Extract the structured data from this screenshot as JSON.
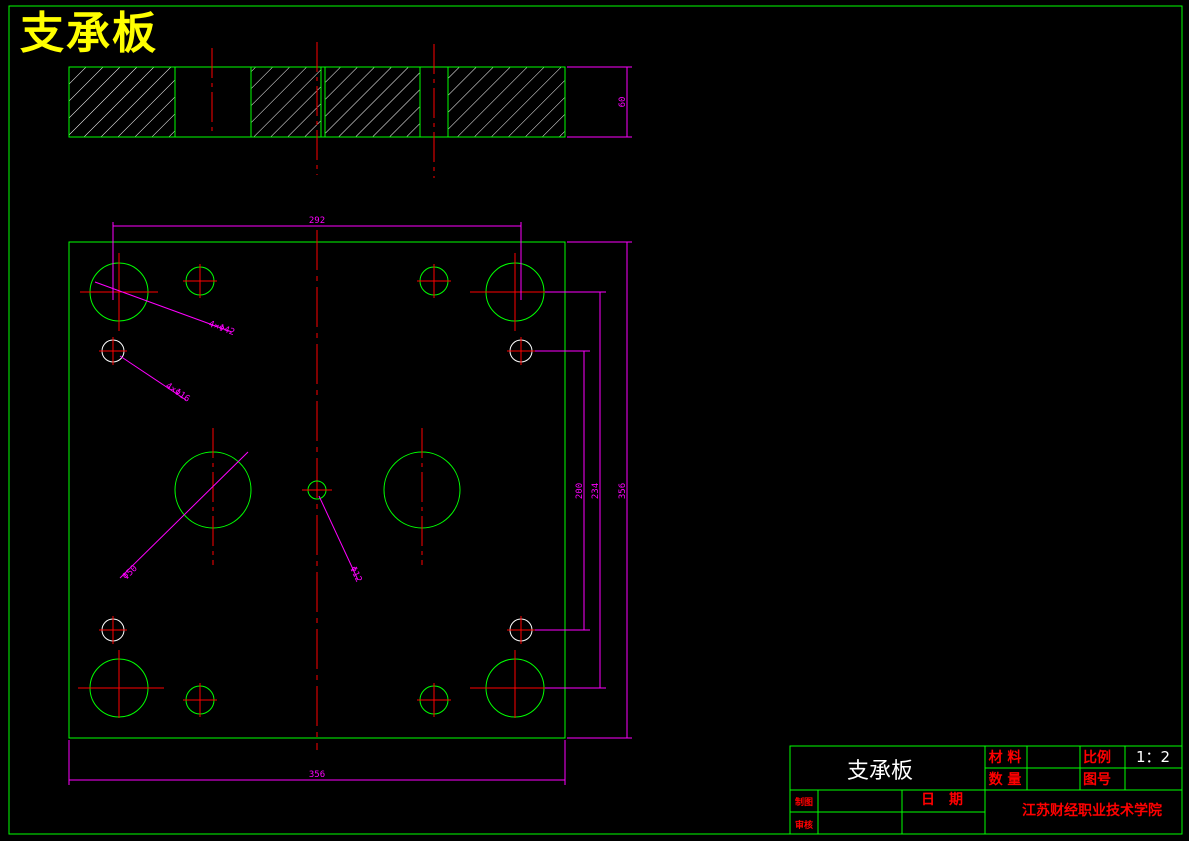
{
  "sheet": {
    "title": "支承板"
  },
  "dimensions": {
    "thickness": "60",
    "hole_spacing_top": "292",
    "hole_spacing_vertical_inner": "200",
    "hole_spacing_vertical_outer": "234",
    "plate_height": "356",
    "plate_width": "356",
    "leader_large_corner": "4×Φ42",
    "leader_small_corner": "4×Φ16",
    "leader_center_large": "Φ50",
    "leader_center_small": "Φ12"
  },
  "title_block": {
    "part_name": "支承板",
    "material_label": "材 料",
    "material_value": "",
    "scale_label": "比例",
    "scale_value": "1：2",
    "quantity_label": "数 量",
    "quantity_value": "",
    "drawing_no_label": "图号",
    "drawing_no_value": "",
    "drawn_by_label": "制图",
    "checked_by_label": "审核",
    "date_label": "日　期",
    "school": "江苏财经职业技术学院"
  },
  "colors": {
    "outline": "#00ff00",
    "centerline": "#ff0000",
    "dimension": "#ff00ff",
    "hatch": "#ffffff",
    "title": "#ffff00"
  }
}
